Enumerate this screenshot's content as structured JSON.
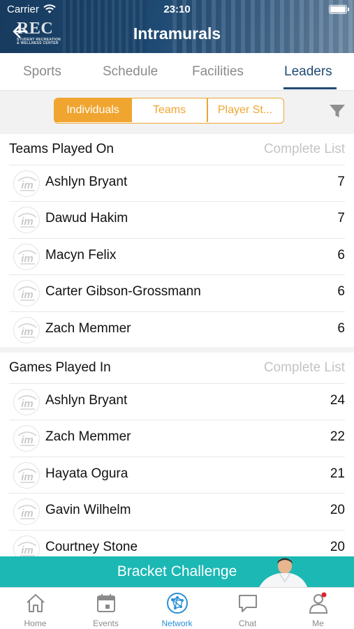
{
  "status_bar": {
    "carrier": "Carrier",
    "time": "23:10"
  },
  "header": {
    "title": "Intramurals",
    "logo_text": "REC",
    "logo_subtext": "STUDENT RECREATION & WELLNESS CENTER"
  },
  "tabs": [
    {
      "label": "Sports"
    },
    {
      "label": "Schedule"
    },
    {
      "label": "Facilities"
    },
    {
      "label": "Leaders",
      "active": true
    }
  ],
  "segmented": {
    "options": [
      "Individuals",
      "Teams",
      "Player St..."
    ],
    "selected": "Individuals"
  },
  "sections": [
    {
      "title": "Teams Played On",
      "link": "Complete List",
      "rows": [
        {
          "name": "Ashlyn Bryant",
          "value": "7"
        },
        {
          "name": "Dawud Hakim",
          "value": "7"
        },
        {
          "name": "Macyn Felix",
          "value": "6"
        },
        {
          "name": "Carter Gibson-Grossmann",
          "value": "6"
        },
        {
          "name": "Zach Memmer",
          "value": "6"
        }
      ]
    },
    {
      "title": "Games Played In",
      "link": "Complete List",
      "rows": [
        {
          "name": "Ashlyn Bryant",
          "value": "24"
        },
        {
          "name": "Zach Memmer",
          "value": "22"
        },
        {
          "name": "Hayata Ogura",
          "value": "21"
        },
        {
          "name": "Gavin Wilhelm",
          "value": "20"
        },
        {
          "name": "Courtney Stone",
          "value": "20"
        }
      ]
    }
  ],
  "banner": {
    "text": "Bracket Challenge"
  },
  "bottom_nav": [
    {
      "label": "Home",
      "icon": "home-icon"
    },
    {
      "label": "Events",
      "icon": "calendar-icon"
    },
    {
      "label": "Network",
      "icon": "network-icon",
      "active": true
    },
    {
      "label": "Chat",
      "icon": "chat-icon"
    },
    {
      "label": "Me",
      "icon": "person-icon",
      "badge": true
    }
  ],
  "colors": {
    "header": "#1f4a73",
    "accent": "#f0a530",
    "active_tab": "#1f4a73",
    "banner": "#1bb8b4",
    "nav_active": "#2a8fd6",
    "badge": "#e0202e"
  }
}
